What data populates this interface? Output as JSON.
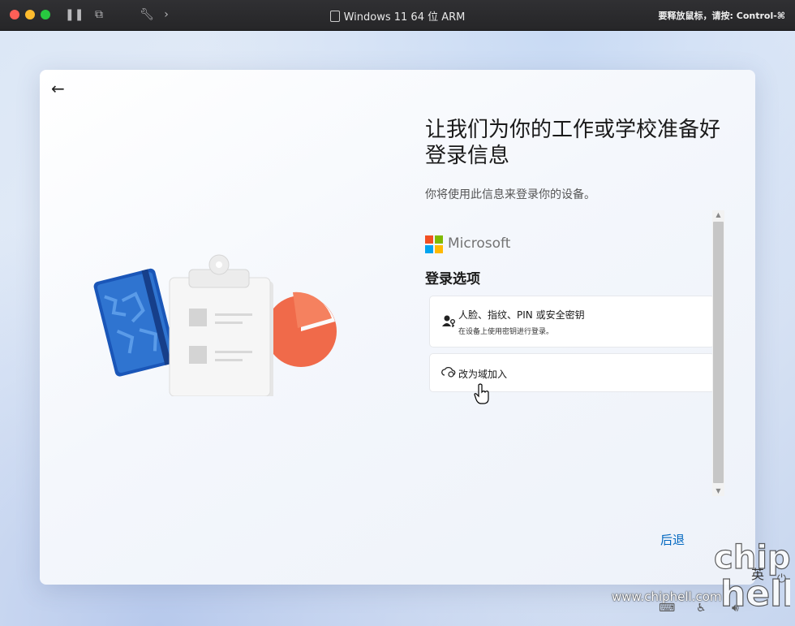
{
  "window": {
    "title": "Windows 11 64 位 ARM",
    "release_hint": "要释放鼠标，请按: Control-⌘"
  },
  "page": {
    "heading": "让我们为你的工作或学校准备好登录信息",
    "subtitle": "你将使用此信息来登录你的设备。",
    "brand": "Microsoft",
    "section_title": "登录选项",
    "options": [
      {
        "label": "人脸、指纹、PIN 或安全密钥",
        "description": "在设备上使用密钥进行登录。",
        "icon": "user-key-icon"
      },
      {
        "label": "改为域加入",
        "icon": "cloud-sync-icon"
      }
    ],
    "next_label": "后退"
  },
  "tray": {
    "language": "英"
  },
  "watermark": {
    "url": "www.chiphell.com",
    "logo_text": "chip hell"
  },
  "colors": {
    "accent": "#0067c0",
    "ms_red": "#f25022",
    "ms_green": "#7fba00",
    "ms_blue": "#00a4ef",
    "ms_yellow": "#ffb900"
  }
}
